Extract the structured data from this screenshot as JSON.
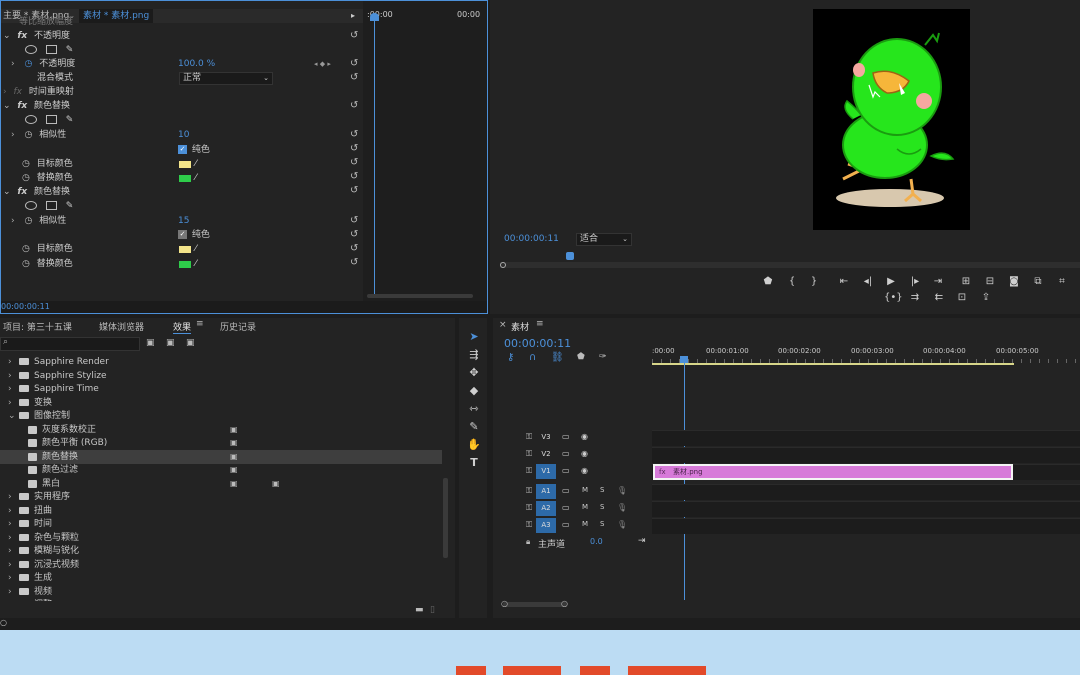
{
  "effect_controls": {
    "tab_main": "主要 * 素材.png",
    "tab_clip": "素材 * 素材.png",
    "tc_start": ":00:00",
    "tc_end": "00:00",
    "top_cut": "等比缩放幅度",
    "opacity_label": "不透明度",
    "opacity_prop": "不透明度",
    "opacity_value": "100.0 %",
    "blend_label": "混合模式",
    "blend_value": "正常",
    "remap_label": "时间重映射",
    "effect1_label": "颜色替换",
    "similarity_label": "相似性",
    "effect1_similarity": "10",
    "pure_color_label": "纯色",
    "target_color_label": "目标颜色",
    "replace_color_label": "替换颜色",
    "effect2_label": "颜色替换",
    "effect2_similarity": "15",
    "footer_timecode": "00:00:00:11",
    "target_swatch": "#f3e48a",
    "replace_swatch": "#2ecc4a"
  },
  "program": {
    "timecode": "00:00:00:11",
    "fit_label": "适合"
  },
  "project": {
    "tabs": [
      "项目: 第三十五课",
      "媒体浏览器",
      "效果",
      "历史记录"
    ],
    "items": [
      {
        "label": "Sapphire Render",
        "indent": 0,
        "type": "folder"
      },
      {
        "label": "Sapphire Stylize",
        "indent": 0,
        "type": "folder"
      },
      {
        "label": "Sapphire Time",
        "indent": 0,
        "type": "folder"
      },
      {
        "label": "变换",
        "indent": 0,
        "type": "folder"
      },
      {
        "label": "图像控制",
        "indent": 0,
        "type": "folder-open"
      },
      {
        "label": "灰度系数校正",
        "indent": 1,
        "type": "fx"
      },
      {
        "label": "颜色平衡 (RGB)",
        "indent": 1,
        "type": "fx"
      },
      {
        "label": "颜色替换",
        "indent": 1,
        "type": "fx",
        "selected": true
      },
      {
        "label": "颜色过滤",
        "indent": 1,
        "type": "fx"
      },
      {
        "label": "黑白",
        "indent": 1,
        "type": "fx",
        "extra": true
      },
      {
        "label": "实用程序",
        "indent": 0,
        "type": "folder"
      },
      {
        "label": "扭曲",
        "indent": 0,
        "type": "folder"
      },
      {
        "label": "时间",
        "indent": 0,
        "type": "folder"
      },
      {
        "label": "杂色与颗粒",
        "indent": 0,
        "type": "folder"
      },
      {
        "label": "模糊与锐化",
        "indent": 0,
        "type": "folder"
      },
      {
        "label": "沉浸式视频",
        "indent": 0,
        "type": "folder"
      },
      {
        "label": "生成",
        "indent": 0,
        "type": "folder"
      },
      {
        "label": "视频",
        "indent": 0,
        "type": "folder"
      },
      {
        "label": "调整",
        "indent": 0,
        "type": "folder"
      }
    ]
  },
  "timeline": {
    "sequence_name": "素材",
    "timecode": "00:00:00:11",
    "ruler": [
      ":00:00",
      "00:00:01:00",
      "00:00:02:00",
      "00:00:03:00",
      "00:00:04:00",
      "00:00:05:00"
    ],
    "tracks": [
      {
        "name": "V3",
        "kind": "video"
      },
      {
        "name": "V2",
        "kind": "video"
      },
      {
        "name": "V1",
        "kind": "video",
        "active": true
      },
      {
        "name": "A1",
        "kind": "audio",
        "active": true
      },
      {
        "name": "A2",
        "kind": "audio",
        "active": true
      },
      {
        "name": "A3",
        "kind": "audio",
        "active": true
      }
    ],
    "master_label": "主声道",
    "master_value": "0.0",
    "clip_name": "素材.png",
    "clip_color": "#d77ad9",
    "track_m": "M",
    "track_s": "S"
  },
  "banner": {
    "bg": "#bcdcf3"
  }
}
